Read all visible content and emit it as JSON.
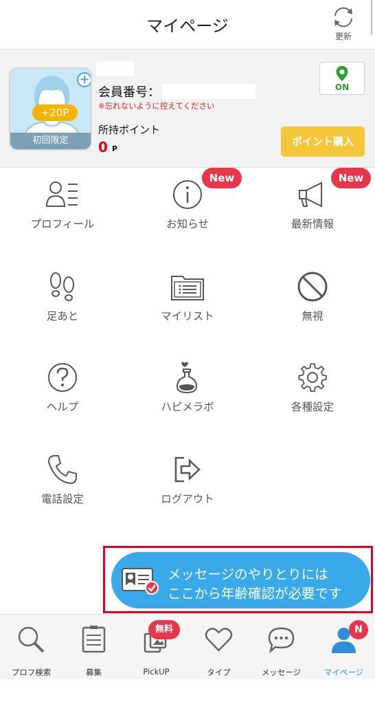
{
  "header": {
    "title": "マイページ",
    "refresh_label": "更新",
    "refresh_icon": "refresh-icon"
  },
  "profile": {
    "avatar_points_badge": "+20P",
    "avatar_limited_label": "初回限定",
    "member_number_label": "会員番号：",
    "warning_text": "※忘れないように控えてください",
    "points_label": "所持ポイント",
    "points_value": "0",
    "points_unit": "P",
    "gps_label": "ON",
    "buy_button_label": "ポイント購入"
  },
  "menu": {
    "items": [
      {
        "label": "プロフィール",
        "icon": "profile-list-icon"
      },
      {
        "label": "お知らせ",
        "icon": "info-icon",
        "badge": "New"
      },
      {
        "label": "最新情報",
        "icon": "megaphone-icon",
        "badge": "New"
      },
      {
        "label": "足あと",
        "icon": "footprints-icon"
      },
      {
        "label": "マイリスト",
        "icon": "folder-list-icon"
      },
      {
        "label": "無視",
        "icon": "block-icon"
      },
      {
        "label": "ヘルプ",
        "icon": "help-icon"
      },
      {
        "label": "ハピメラボ",
        "icon": "flask-icon"
      },
      {
        "label": "各種設定",
        "icon": "gear-icon"
      },
      {
        "label": "電話設定",
        "icon": "phone-icon"
      },
      {
        "label": "ログアウト",
        "icon": "logout-icon"
      }
    ]
  },
  "age_banner": {
    "line1": "メッセージのやりとりには",
    "line2": "ここから年齢確認が必要です"
  },
  "tabbar": {
    "items": [
      {
        "label": "プロフ検索",
        "icon": "search-icon"
      },
      {
        "label": "募集",
        "icon": "board-icon"
      },
      {
        "label": "PickUP",
        "icon": "pickup-icon",
        "badge": "無料"
      },
      {
        "label": "タイプ",
        "icon": "heart-icon"
      },
      {
        "label": "メッセージ",
        "icon": "chat-icon"
      },
      {
        "label": "マイページ",
        "icon": "user-icon",
        "badge": "N"
      }
    ],
    "active_color": "#2d8fd8"
  },
  "colors": {
    "accent_red": "#e8354a",
    "points_orange": "#f6b400",
    "buy_button": "#f6c63a",
    "banner_blue": "#39a9ea",
    "gps_green": "#2aa32a"
  }
}
